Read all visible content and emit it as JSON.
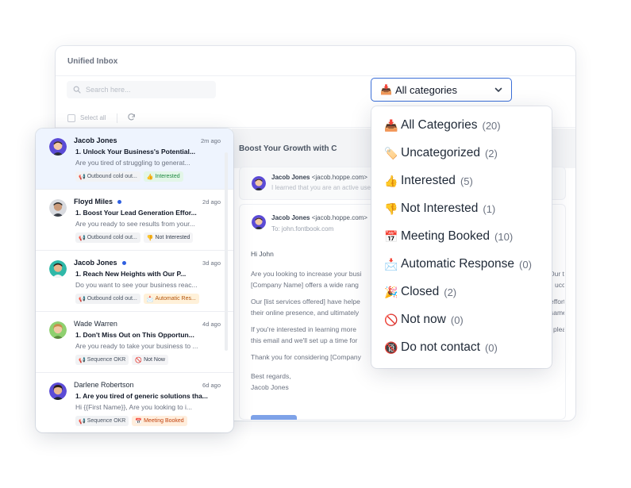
{
  "inbox": {
    "title": "Unified Inbox",
    "search_placeholder": "Search here...",
    "select_all_label": "Select all",
    "category_select": {
      "emoji": "📥",
      "value": "All categories"
    }
  },
  "thread": {
    "subject": "Boost Your Growth with C",
    "collapsed": {
      "sender_name": "Jacob Jones",
      "sender_email": "<jacob.hoppe.com>",
      "preview": "I learned that you are an active use"
    },
    "message": {
      "sender_name": "Jacob Jones",
      "sender_email": "<jacob.hoppe.com>",
      "to": "To: john.fontbook.com",
      "greeting": "Hi John",
      "paragraph1_line1": "Are you looking to increase your busi",
      "paragraph1_line1_tail": "Our te",
      "paragraph1_line2": "[Company Name] offers a wide rang",
      "paragraph1_line2_tail": "ucceed.",
      "paragraph2_line1": "Our [list services offered] have helpe",
      "paragraph2_line1_tail": "efforts,",
      "paragraph2_line2": "their online presence, and ultimately",
      "paragraph2_line2_tail": "same fo",
      "paragraph3_line1": "If you're interested in learning more",
      "paragraph3_line1_tail": "please",
      "paragraph3_line2": "this email and we'll set up a time for",
      "closing_line": "Thank you for considering [Company",
      "sign_off": "Best regards,",
      "signature": "Jacob Jones"
    }
  },
  "emails": [
    {
      "sender": "Jacob Jones",
      "unread": false,
      "time": "2m ago",
      "subject": "1. Unlock Your Business's Potential...",
      "snippet": "Are you tired of struggling to generat...",
      "campaign": "Outbound cold out...",
      "category": "Interested",
      "category_emoji": "👍",
      "category_style": "interested"
    },
    {
      "sender": "Floyd Miles",
      "unread": true,
      "time": "2d ago",
      "subject": "1. Boost Your Lead Generation Effor...",
      "snippet": "Are you ready to see results from your...",
      "campaign": "Outbound cold out...",
      "category": "Not Interested",
      "category_emoji": "👎",
      "category_style": "notinterested"
    },
    {
      "sender": "Jacob Jones",
      "unread": true,
      "time": "3d ago",
      "subject": "1. Reach New Heights with Our P...",
      "snippet": "Do you want to see your business reac...",
      "campaign": "Outbound cold out...",
      "category": "Automatic Res...",
      "category_emoji": "📩",
      "category_style": "auto"
    },
    {
      "sender": "Wade Warren",
      "unread": false,
      "time": "4d ago",
      "subject": "1. Don't Miss Out on This Opportun...",
      "snippet": "Are you ready to take your business to ...",
      "campaign": "Sequence OKR",
      "category": "Not Now",
      "category_emoji": "🚫",
      "category_style": "notnow"
    },
    {
      "sender": "Darlene Robertson",
      "unread": false,
      "time": "6d ago",
      "subject": "1. Are you tired of generic solutions tha...",
      "snippet": "Hi {{First Name}}, Are you looking to i...",
      "campaign": "Sequence OKR",
      "category": "Meeting Booked",
      "category_emoji": "📅",
      "category_style": "meeting"
    }
  ],
  "categories": [
    {
      "emoji": "📥",
      "name": "All Categories",
      "count": "(20)"
    },
    {
      "emoji": "🏷️",
      "name": "Uncategorized",
      "count": "(2)"
    },
    {
      "emoji": "👍",
      "name": "Interested",
      "count": "(5)"
    },
    {
      "emoji": "👎",
      "name": "Not Interested",
      "count": "(1)"
    },
    {
      "emoji": "📅",
      "name": "Meeting Booked",
      "count": "(10)"
    },
    {
      "emoji": "📩",
      "name": "Automatic Response",
      "count": "(0)"
    },
    {
      "emoji": "🎉",
      "name": "Closed",
      "count": "(2)"
    },
    {
      "emoji": "🚫",
      "name": "Not now",
      "count": "(0)"
    },
    {
      "emoji": "🔞",
      "name": "Do not contact",
      "count": "(0)"
    }
  ],
  "colors": {
    "accent": "#3b6fd8",
    "unread_dot": "#2f5fe0",
    "active_row": "#eef4fe"
  }
}
